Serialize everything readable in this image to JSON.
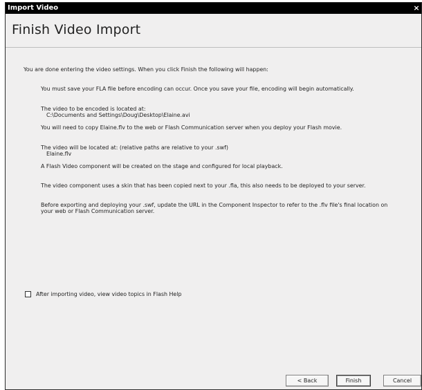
{
  "window": {
    "title": "Import Video",
    "close_glyph": "×"
  },
  "header": {
    "title": "Finish Video Import"
  },
  "content": {
    "intro": "You are done entering the video settings. When you click Finish the following will happen:",
    "items": [
      "You must save your FLA file before encoding can occur. Once you save your file, encoding will begin automatically.",
      "The video to be encoded is located at:",
      "C:\\Documents and Settings\\Doug\\Desktop\\Elaine.avi",
      "You will need to copy Elaine.flv to the web or Flash Communication server when you deploy your Flash movie.",
      "The video will be located at: (relative paths are relative to your .swf)",
      "Elaine.flv",
      "A Flash Video component will be created on the stage and configured for local playback.",
      "The video component uses a skin that has been copied next to your .fla, this also needs to be deployed to your server.",
      "Before exporting and deploying your .swf, update the URL in the Component Inspector to refer to the .flv file's final location on",
      "your web or Flash Communication server."
    ]
  },
  "checkbox": {
    "label": "After importing video, view video topics in Flash Help",
    "checked": false
  },
  "buttons": {
    "back": "< Back",
    "finish": "Finish",
    "cancel": "Cancel"
  }
}
